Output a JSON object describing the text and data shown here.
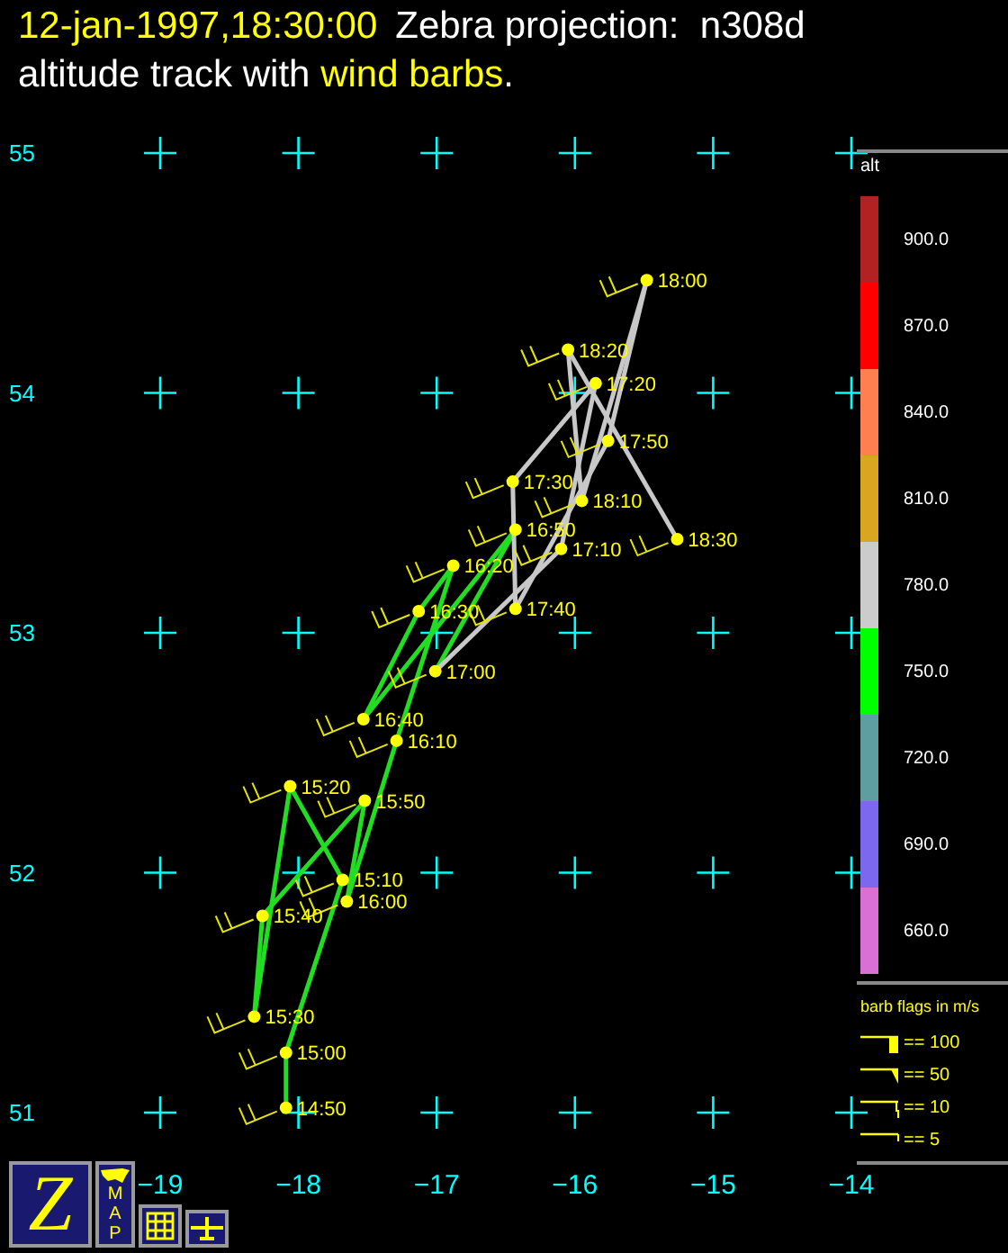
{
  "header": {
    "timestamp": "12-jan-1997,18:30:00",
    "title": "Zebra projection:  n308d",
    "subtitle": [
      {
        "text": "altitude track with ",
        "highlight": false
      },
      {
        "text": "wind barbs",
        "highlight": true
      },
      {
        "text": ".",
        "highlight": false
      }
    ]
  },
  "plot": {
    "chart_data": {
      "type": "scatter",
      "xlim": [
        -19,
        -14
      ],
      "ylim": [
        51,
        55
      ],
      "xticks": [
        -19,
        -18,
        -17,
        -16,
        -15,
        -14
      ],
      "yticks": [
        51,
        52,
        53,
        54,
        55
      ],
      "x": [
        -18.09,
        -18.09,
        -17.68,
        -18.06,
        -18.32,
        -18.26,
        -17.52,
        -17.65,
        -17.29,
        -16.88,
        -17.13,
        -17.53,
        -16.43,
        -17.01,
        -16.1,
        -15.85,
        -16.45,
        -16.43,
        -15.76,
        -15.48,
        -15.95,
        -16.05,
        -15.26
      ],
      "series": [
        {
          "color": "#ffff00",
          "values": [
            51.02,
            51.25,
            51.97,
            52.36,
            51.4,
            51.82,
            52.3,
            51.88,
            52.55,
            53.28,
            53.09,
            52.64,
            53.43,
            52.84,
            53.35,
            54.04,
            53.63,
            53.1,
            53.8,
            54.47,
            53.55,
            54.18,
            53.39
          ]
        }
      ],
      "annotations": [
        {
          "x": -18.09,
          "y": 51.02,
          "text": "14:50"
        },
        {
          "x": -18.09,
          "y": 51.25,
          "text": "15:00"
        },
        {
          "x": -17.68,
          "y": 51.97,
          "text": "15:10"
        },
        {
          "x": -18.06,
          "y": 52.36,
          "text": "15:20"
        },
        {
          "x": -18.32,
          "y": 51.4,
          "text": "15:30"
        },
        {
          "x": -18.26,
          "y": 51.82,
          "text": "15:40"
        },
        {
          "x": -17.52,
          "y": 52.3,
          "text": "15:50"
        },
        {
          "x": -17.65,
          "y": 51.88,
          "text": "16:00"
        },
        {
          "x": -17.29,
          "y": 52.55,
          "text": "16:10"
        },
        {
          "x": -16.88,
          "y": 53.28,
          "text": "16:20"
        },
        {
          "x": -17.13,
          "y": 53.09,
          "text": "16:30"
        },
        {
          "x": -17.53,
          "y": 52.64,
          "text": "16:40"
        },
        {
          "x": -16.43,
          "y": 53.43,
          "text": "16:50"
        },
        {
          "x": -17.01,
          "y": 52.84,
          "text": "17:00"
        },
        {
          "x": -16.1,
          "y": 53.35,
          "text": "17:10"
        },
        {
          "x": -15.85,
          "y": 54.04,
          "text": "17:20"
        },
        {
          "x": -16.45,
          "y": 53.63,
          "text": "17:30"
        },
        {
          "x": -16.43,
          "y": 53.1,
          "text": "17:40"
        },
        {
          "x": -15.76,
          "y": 53.8,
          "text": "17:50"
        },
        {
          "x": -15.48,
          "y": 54.47,
          "text": "18:00"
        },
        {
          "x": -15.95,
          "y": 53.55,
          "text": "18:10"
        },
        {
          "x": -16.05,
          "y": 54.18,
          "text": "18:20"
        },
        {
          "x": -15.26,
          "y": 53.39,
          "text": "18:30"
        }
      ]
    }
  },
  "legend": {
    "title": "alt",
    "scale": [
      {
        "label": "900.0",
        "color": "#b22222"
      },
      {
        "label": "870.0",
        "color": "#ff0000"
      },
      {
        "label": "840.0",
        "color": "#ff7f50"
      },
      {
        "label": "810.0",
        "color": "#daa520"
      },
      {
        "label": "780.0",
        "color": "#cccccc"
      },
      {
        "label": "750.0",
        "color": "#00ff00"
      },
      {
        "label": "720.0",
        "color": "#5f9ea0"
      },
      {
        "label": "690.0",
        "color": "#7b68ee"
      },
      {
        "label": "660.0",
        "color": "#da70d6"
      }
    ],
    "barb_title": "barb flags in m/s",
    "barbs": [
      {
        "kind": "flag",
        "label": "== 100"
      },
      {
        "kind": "pennant",
        "label": "== 50"
      },
      {
        "kind": "full",
        "label": "== 10"
      },
      {
        "kind": "half",
        "label": "== 5"
      }
    ]
  },
  "toolbar": [
    {
      "kind": "logo",
      "text": "Z"
    },
    {
      "kind": "map",
      "text": "MAP"
    },
    {
      "kind": "grid"
    },
    {
      "kind": "plane"
    }
  ]
}
